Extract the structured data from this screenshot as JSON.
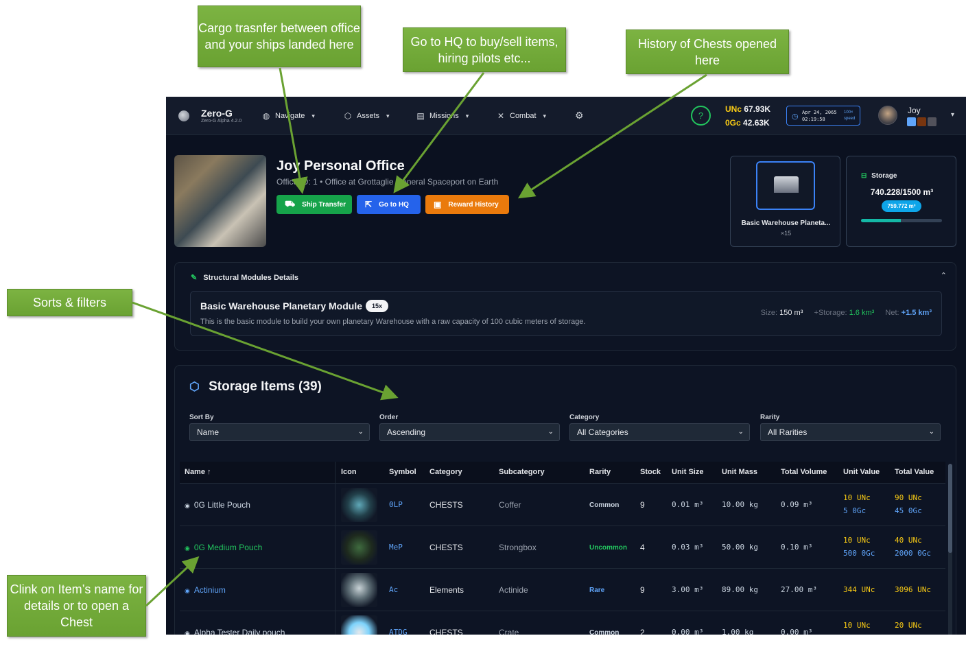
{
  "nav": {
    "brand_name": "Zero-G",
    "brand_version": "Zero-G Alpha 4.2.0",
    "items": [
      {
        "label": "Navigate",
        "icon": "globe-icon"
      },
      {
        "label": "Assets",
        "icon": "cube-icon"
      },
      {
        "label": "Missions",
        "icon": "scroll-icon"
      },
      {
        "label": "Combat",
        "icon": "swords-icon"
      }
    ],
    "currency": {
      "unc_label": "UNc",
      "unc_value": "67.93K",
      "ogc_label": "0Gc",
      "ogc_value": "42.63K"
    },
    "clock": {
      "date": "Apr 24, 2065",
      "time": "02:19:58",
      "speed_value": "100×",
      "speed_label": "speed"
    },
    "user": {
      "name": "Joy"
    }
  },
  "office": {
    "title": "Joy Personal Office",
    "subtitle": "Office ID: 1 • Office at Grottaglie General Spaceport on Earth",
    "buttons": {
      "ship_transfer": "Ship Transfer",
      "go_to_hq": "Go to HQ",
      "reward_history": "Reward History"
    },
    "warehouse": {
      "title": "Basic Warehouse Planeta...",
      "count": "×15"
    },
    "storage": {
      "label": "Storage",
      "value": "740.228/1500 m³",
      "free": "759.772 m³",
      "fill_fraction": 0.493
    }
  },
  "structural": {
    "heading": "Structural Modules Details",
    "module": {
      "name": "Basic Warehouse Planetary Module",
      "qty": "15x",
      "description": "This is the basic module to build your own planetary Warehouse with a raw capacity of 100 cubic meters of storage.",
      "size_label": "Size:",
      "size_value": "150 m³",
      "storage_label": "+Storage:",
      "storage_value": "1.6 km³",
      "net_label": "Net:",
      "net_value": "+1.5 km³"
    }
  },
  "storage_items": {
    "title": "Storage Items (39)",
    "filters": [
      {
        "label": "Sort By",
        "value": "Name"
      },
      {
        "label": "Order",
        "value": "Ascending"
      },
      {
        "label": "Category",
        "value": "All Categories"
      },
      {
        "label": "Rarity",
        "value": "All Rarities"
      }
    ],
    "columns": [
      "Name ↑",
      "Icon",
      "Symbol",
      "Category",
      "Subcategory",
      "Rarity",
      "Stock",
      "Unit Size",
      "Unit Mass",
      "Total Volume",
      "Unit Value",
      "Total Value"
    ],
    "rows": [
      {
        "name": "0G Little Pouch",
        "symbol": "0LP",
        "category": "CHESTS",
        "subcategory": "Coffer",
        "rarity": "Common",
        "stock": "9",
        "unit_size": "0.01 m³",
        "unit_mass": "10.00 kg",
        "total_volume": "0.09 m³",
        "unit_value_unc": "10 UNc",
        "unit_value_ogc": "5 0Gc",
        "total_value_unc": "90 UNc",
        "total_value_ogc": "45 0Gc"
      },
      {
        "name": "0G Medium Pouch",
        "symbol": "MeP",
        "category": "CHESTS",
        "subcategory": "Strongbox",
        "rarity": "Uncommon",
        "stock": "4",
        "unit_size": "0.03 m³",
        "unit_mass": "50.00 kg",
        "total_volume": "0.10 m³",
        "unit_value_unc": "10 UNc",
        "unit_value_ogc": "500 0Gc",
        "total_value_unc": "40 UNc",
        "total_value_ogc": "2000 0Gc"
      },
      {
        "name": "Actinium",
        "symbol": "Ac",
        "category": "Elements",
        "subcategory": "Actinide",
        "rarity": "Rare",
        "stock": "9",
        "unit_size": "3.00 m³",
        "unit_mass": "89.00 kg",
        "total_volume": "27.00 m³",
        "unit_value_unc": "344 UNc",
        "unit_value_ogc": "",
        "total_value_unc": "3096 UNc",
        "total_value_ogc": ""
      },
      {
        "name": "Alpha Tester Daily pouch",
        "symbol": "ATDG",
        "category": "CHESTS",
        "subcategory": "Crate",
        "rarity": "Common",
        "stock": "2",
        "unit_size": "0.00 m³",
        "unit_mass": "1.00 kg",
        "total_volume": "0.00 m³",
        "unit_value_unc": "10 UNc",
        "unit_value_ogc": "",
        "total_value_unc": "20 UNc",
        "total_value_ogc": ""
      }
    ]
  },
  "annotations": {
    "cargo": "Cargo trasnfer between office and your ships landed here",
    "hq": "Go to HQ to buy/sell items, hiring pilots etc...",
    "chests": "History of Chests opened here",
    "sorts": "Sorts & filters",
    "click": "Clink on Item’s name for details or to open a Chest"
  },
  "colors": {
    "accent_green": "#16a34a",
    "accent_blue": "#2563eb",
    "accent_orange": "#ea7a0c",
    "callout_green": "#70a83a",
    "unc_yellow": "#facc15",
    "ogc_blue": "#60a5fa",
    "common": "#cbd5e1",
    "uncommon": "#22c55e",
    "rare": "#60a5fa"
  }
}
